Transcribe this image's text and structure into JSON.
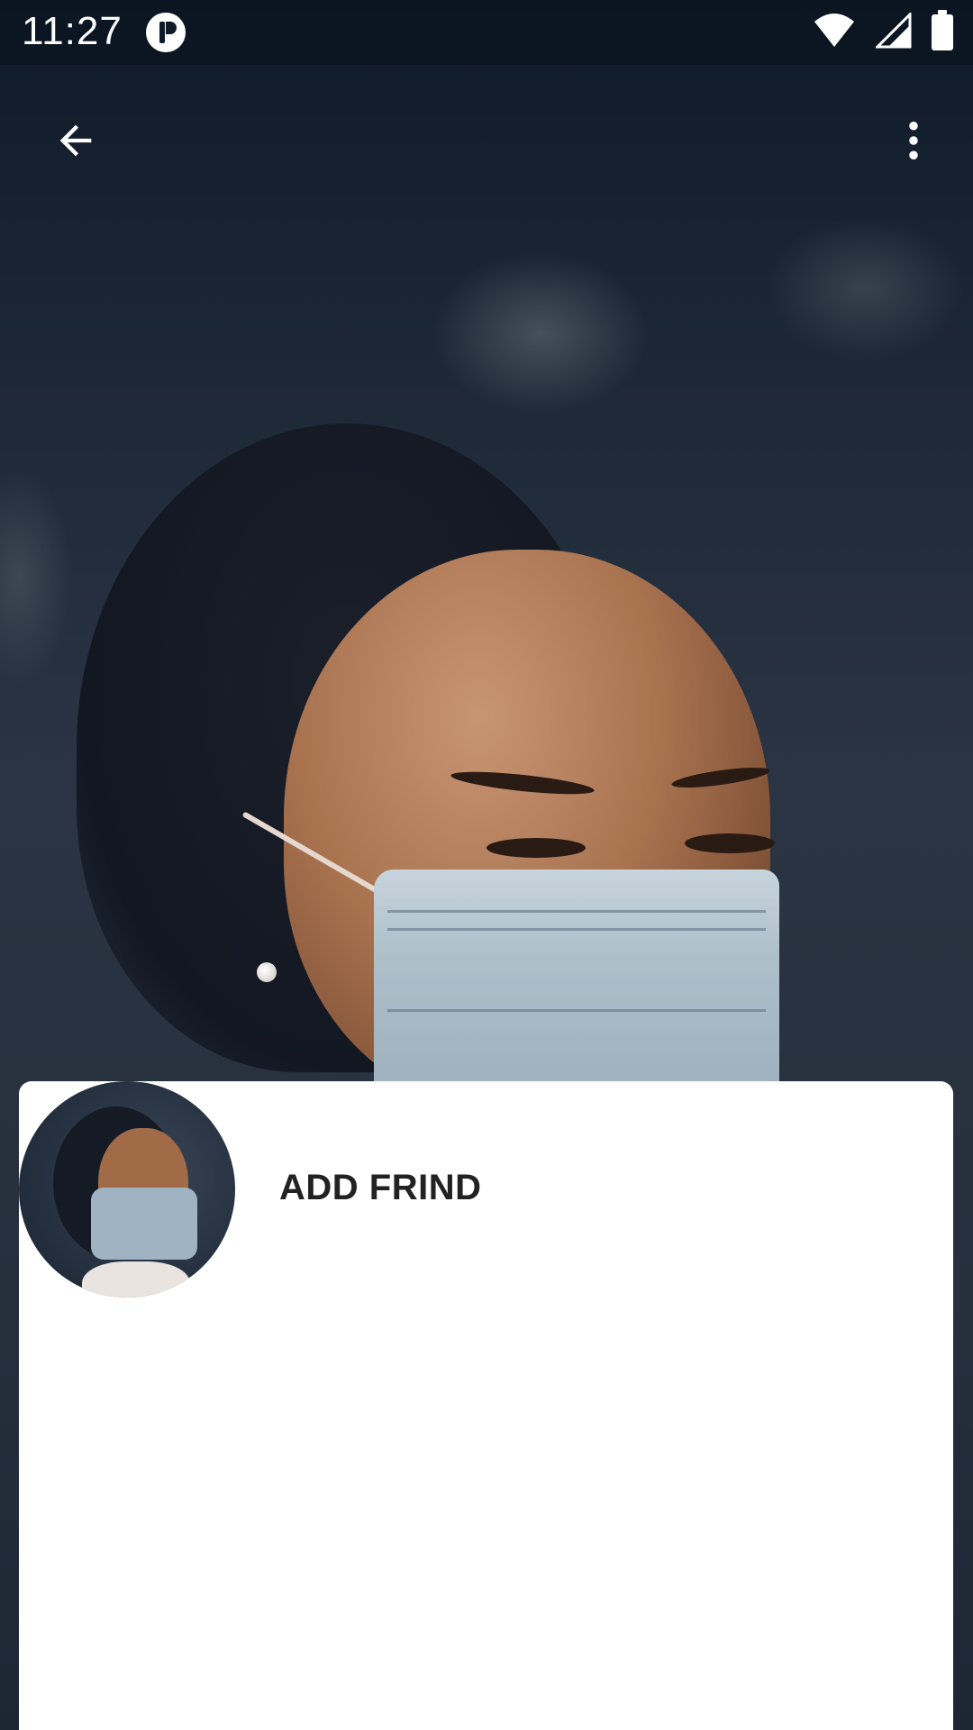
{
  "status_bar": {
    "time": "11:27",
    "icons": [
      "app-notification-icon",
      "wifi-icon",
      "signal-icon",
      "battery-icon"
    ]
  },
  "toolbar": {
    "back_icon": "arrow-back-icon",
    "more_icon": "more-vert-icon"
  },
  "card": {
    "title": "ADD FRIND"
  },
  "colors": {
    "card_background": "#ffffff",
    "title_text": "#222222",
    "toolbar_icons": "#ffffff"
  }
}
